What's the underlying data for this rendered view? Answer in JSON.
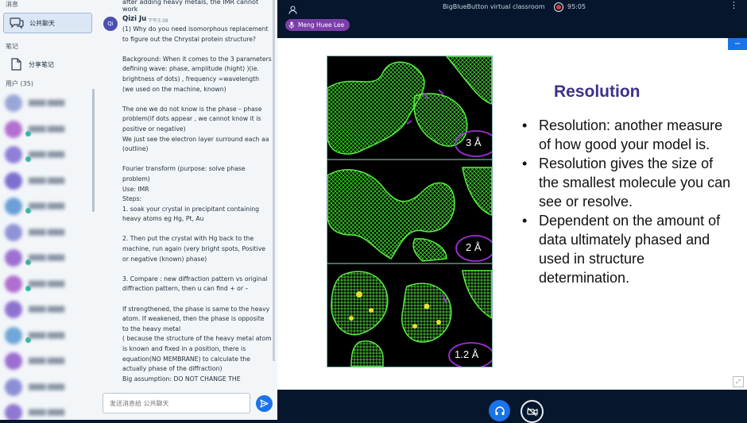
{
  "sidebar": {
    "messages_section": "消息",
    "public_chat": "公共聊天",
    "notes_section": "笔记",
    "shared_notes": "分享笔记",
    "users_section": "用户 (35)"
  },
  "chat": {
    "prev_message_tail": "after adding heavy metals, the IMR cannot work",
    "author": "Qizi Ju",
    "author_initials": "Qi",
    "time": "下午3:38",
    "body": "(1) Why do you need isomorphous replacement to figure out the Chrystal protein structure?\n\nBackground: When it comes to the 3 parameters defining wave: phase, amplitude (hight) )(ie. brightness of dots) , frequency =wavelength (we used on the machine, known)\n\nThe one we do not know is the phase – phase problem(if dots appear , we cannot know it is positive or negative)\nWe just see the electron layer surround each aa (outline)\n\nFourier transform (purpose: solve phase problem)\nUse: IMR\nSteps:\n1. soak your crystal in precipitant containing heavy atoms eg Hg, Pt, Au\n\n2. Then put the crystal with Hg back to the machine, run again (very bright spots, Positive or negative (known) phase)\n\n3. Compare : new diffraction pattern vs original diffraction pattern, then u can find + or –\n\nIf strengthened, the phase is same to the heavy atom. If weakened, then the phase is opposite to the heavy metal\n( because the structure of the heavy metal atom is known and fixed in a position, there is equation(NO MEMBRANE) to calculate the actually phase of the diffraction)\nBig assumption: DO NOT CHANGE THE",
    "input_placeholder": "发送消息给 公共聊天"
  },
  "topbar": {
    "title": "BigBlueButton virtual classroom",
    "timer": "95:05",
    "presenter": "Meng Huee Lee"
  },
  "slide": {
    "title": "Resolution",
    "bullets": [
      "Resolution:  another measure of how good your model is.",
      "Resolution gives the size of the smallest molecule you can see or resolve.",
      "Dependent on the amount of data ultimately phased and used in structure determination."
    ],
    "image_labels": [
      "3 Å",
      "2 Å",
      "1.2 Å"
    ]
  },
  "colors": {
    "dark_bg": "#06172d",
    "accent_blue": "#1a73e8",
    "presenter_purple": "#7b3fa8",
    "slide_title": "#3c3189",
    "density_green": "#39d12a",
    "annotation_purple": "#a02fd6"
  },
  "icons": {
    "chat": "chat-bubbles-icon",
    "notes": "note-document-icon",
    "send": "send-arrow-icon",
    "user": "user-icon",
    "record": "record-icon",
    "menu": "kebab-menu-icon",
    "mic": "microphone-icon",
    "audio": "headphones-icon",
    "video": "video-off-icon",
    "fullscreen": "fullscreen-icon"
  },
  "users": [
    {
      "color": "#9aa6d8"
    },
    {
      "color": "#b46fd0"
    },
    {
      "color": "#8f7fd8"
    },
    {
      "color": "#7b6fcf"
    },
    {
      "color": "#6a9fd8"
    },
    {
      "color": "#8f93d6"
    },
    {
      "color": "#9f70d3"
    },
    {
      "color": "#b06ed0"
    },
    {
      "color": "#8e72d0"
    },
    {
      "color": "#6fa7d8"
    },
    {
      "color": "#9c6ed2"
    },
    {
      "color": "#8d8fd6"
    },
    {
      "color": "#8f78d2"
    }
  ]
}
